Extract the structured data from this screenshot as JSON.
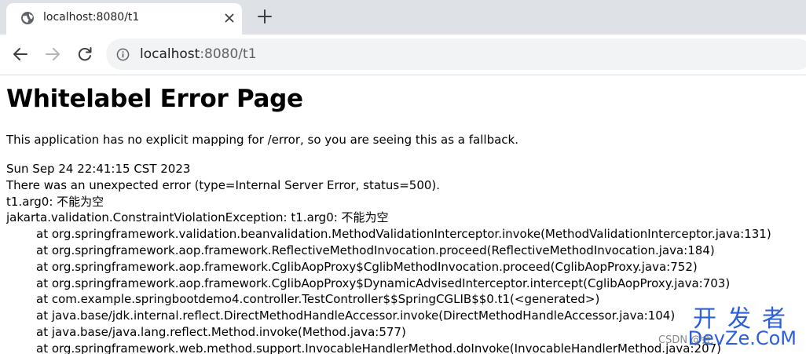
{
  "browser": {
    "tab": {
      "title": "localhost:8080/t1",
      "favicon": "globe-icon"
    },
    "address_bar": {
      "host": "localhost",
      "rest": ":8080/t1",
      "security_icon": "info-icon"
    },
    "nav": [
      "back-arrow-icon",
      "forward-arrow-icon",
      "reload-icon"
    ],
    "colors": {
      "tabstrip": "#dee1e6",
      "omnibox": "#f1f3f4"
    }
  },
  "page": {
    "title": "Whitelabel Error Page",
    "intro": "This application has no explicit mapping for /error, so you are seeing this as a fallback.",
    "timestamp": "Sun Sep 24 22:41:15 CST 2023",
    "error_summary": "There was an unexpected error (type=Internal Server Error, status=500).",
    "message": "t1.arg0: 不能为空",
    "exception": "jakarta.validation.ConstraintViolationException: t1.arg0: 不能为空",
    "stack_trace": [
      "at org.springframework.validation.beanvalidation.MethodValidationInterceptor.invoke(MethodValidationInterceptor.java:131)",
      "at org.springframework.aop.framework.ReflectiveMethodInvocation.proceed(ReflectiveMethodInvocation.java:184)",
      "at org.springframework.aop.framework.CglibAopProxy$CglibMethodInvocation.proceed(CglibAopProxy.java:752)",
      "at org.springframework.aop.framework.CglibAopProxy$DynamicAdvisedInterceptor.intercept(CglibAopProxy.java:703)",
      "at com.example.springbootdemo4.controller.TestController$$SpringCGLIB$$0.t1(<generated>)",
      "at java.base/jdk.internal.reflect.DirectMethodHandleAccessor.invoke(DirectMethodHandleAccessor.java:104)",
      "at java.base/java.lang.reflect.Method.invoke(Method.java:577)",
      "at org.springframework.web.method.support.InvocableHandlerMethod.doInvoke(InvocableHandlerMethod.java:207)"
    ]
  },
  "watermark": {
    "chinese": "开发者",
    "csdn": "CSDN @会",
    "devze": "DevZe.CoM"
  }
}
